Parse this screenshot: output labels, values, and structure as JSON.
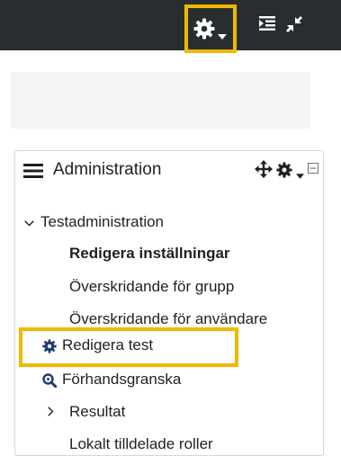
{
  "topbar": {
    "icons": [
      "gear-icon",
      "chevron-down-icon",
      "blocks-drawer-icon",
      "collapse-arrows-icon"
    ],
    "highlight_color": "#f0b800",
    "background": "#2a2d30"
  },
  "admin": {
    "title": "Administration",
    "header_icons": [
      "hamburger-icon",
      "move-icon",
      "gear-icon",
      "chevron-down-icon",
      "minimize-icon"
    ],
    "tree": {
      "section": "Testadministration",
      "items": [
        "Redigera inställningar",
        "Överskridande för grupp",
        "Överskridande för användare",
        "Redigera test",
        "Förhandsgranska",
        "Resultat",
        "Lokalt tilldelade roller"
      ]
    }
  }
}
